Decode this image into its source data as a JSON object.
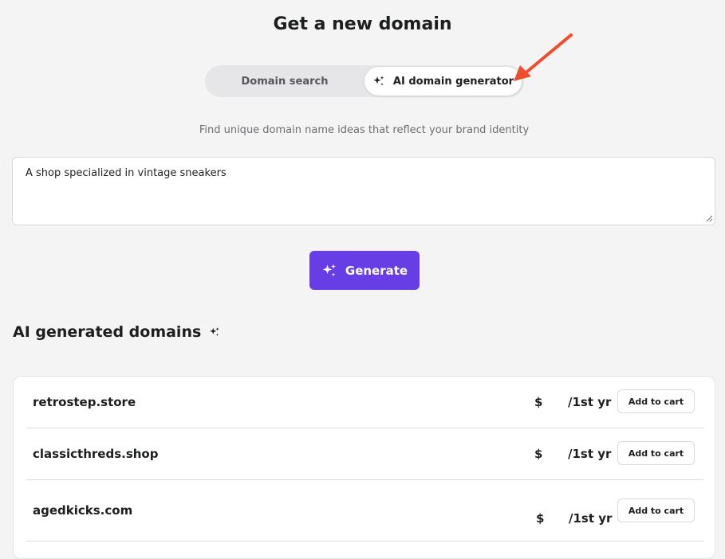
{
  "header": {
    "title": "Get a new domain"
  },
  "tabs": {
    "search_label": "Domain search",
    "ai_label": "AI domain generator"
  },
  "subtitle": "Find unique domain name ideas that reflect your brand identity",
  "prompt": {
    "value": "A shop specialized in vintage sneakers"
  },
  "generate": {
    "label": "Generate"
  },
  "results": {
    "title": "AI generated domains",
    "rows": [
      {
        "domain": "retrostep.store",
        "currency": "$",
        "period": "/1st yr",
        "button": "Add to cart"
      },
      {
        "domain": "classicthreds.shop",
        "currency": "$",
        "period": "/1st yr",
        "button": "Add to cart"
      },
      {
        "domain": "agedkicks.com",
        "currency": "$",
        "period": "/1st yr",
        "button": "Add to cart"
      }
    ]
  },
  "colors": {
    "accent": "#673de6",
    "annotation_arrow": "#ee4c2c"
  }
}
